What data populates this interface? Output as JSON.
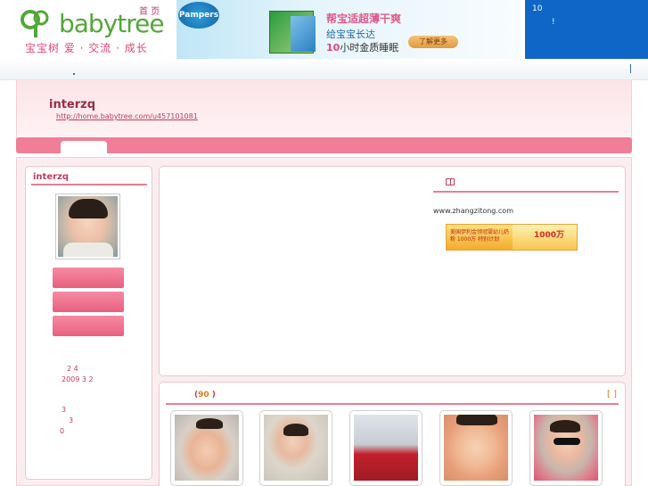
{
  "header": {
    "logo_text": "babytree",
    "logo_tagline": "宝宝树   爱 · 交流 · 成长",
    "home_link": "首 页"
  },
  "banner": {
    "brand": "Pampers",
    "line1": "帮宝适超薄干爽",
    "line2": "给宝宝长达",
    "line3_num": "10",
    "line3_rest": "小时金质睡眠",
    "button": "了解更多"
  },
  "bluebox": {
    "num": "10",
    "mark": "!"
  },
  "profile": {
    "username": "interzq",
    "url": "http://home.babytree.com/u457101081"
  },
  "sidebar": {
    "title": "interzq",
    "stat1": "2 4",
    "stat2": "2009 3 2",
    "stat3": "3",
    "stat4": "3",
    "stat5": "0"
  },
  "main": {
    "site_link": "www.zhangzitong.com",
    "ad_left_text": "美国伊利金领冠婴幼儿奶粉 1000万 特别计划",
    "ad_right_text": "1000万"
  },
  "album": {
    "label_open": "(",
    "count": "90",
    "label_close": ")",
    "more": "[ ]"
  },
  "colors": {
    "accent_pink": "#ef7e96",
    "title_red": "#c23a5f",
    "blue": "#0f66c7",
    "orange": "#e07b1a"
  }
}
